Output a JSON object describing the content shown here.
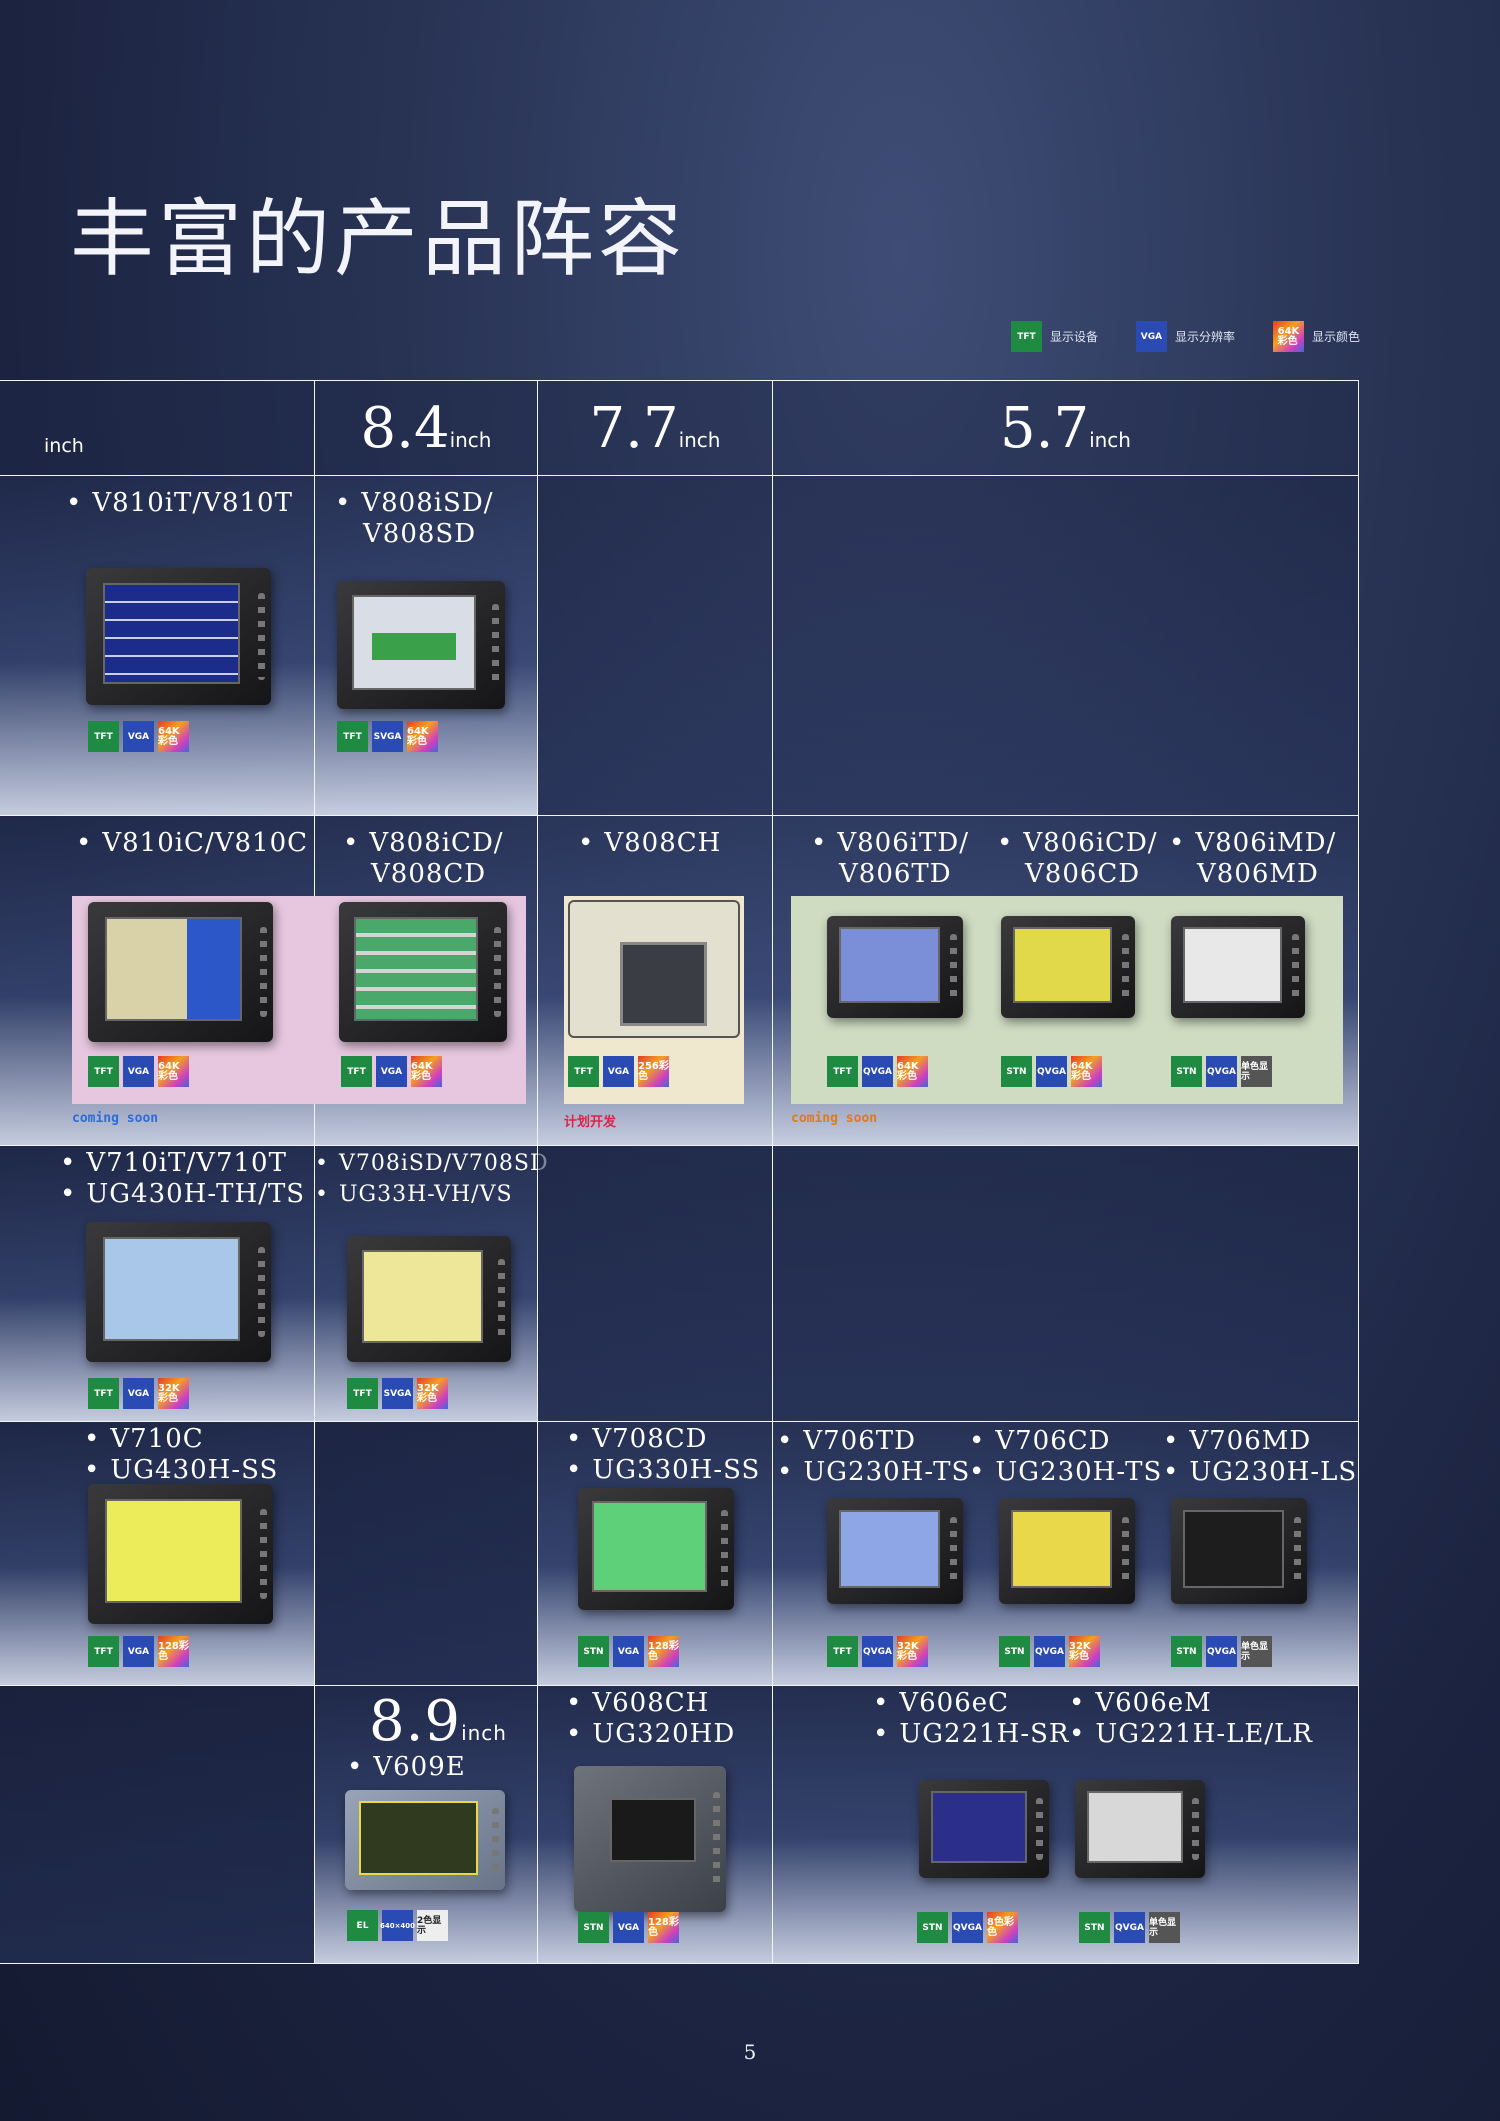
{
  "title": "丰富的产品阵容",
  "legend": [
    {
      "badge": "TFT",
      "label": "显示设备",
      "kind": "tft"
    },
    {
      "badge": "VGA",
      "label": "显示分辨率",
      "kind": "vga"
    },
    {
      "badge": "64K\n彩色",
      "label": "显示颜色",
      "kind": "col"
    }
  ],
  "headers": {
    "col1": "inch",
    "col2_num": "8.4",
    "col3_num": "7.7",
    "col4_num": "5.7",
    "unit": "inch"
  },
  "rows": {
    "r1": {
      "c1": [
        "V810iT/V810T"
      ],
      "c2": [
        "V808iSD/",
        "V808SD"
      ],
      "c1_badges": [
        "TFT",
        "VGA",
        "64K彩色"
      ],
      "c2_badges": [
        "TFT",
        "SVGA",
        "64K彩色"
      ]
    },
    "r2": {
      "c1": [
        "V810iC/V810C"
      ],
      "c2": [
        "V808iCD/",
        "V808CD"
      ],
      "c3": [
        "V808CH"
      ],
      "c4a": [
        "V806iTD/",
        "V806TD"
      ],
      "c4b": [
        "V806iCD/",
        "V806CD"
      ],
      "c4c": [
        "V806iMD/",
        "V806MD"
      ],
      "c1_badges": [
        "TFT",
        "VGA",
        "64K彩色"
      ],
      "c2_badges": [
        "TFT",
        "VGA",
        "64K彩色"
      ],
      "c3_badges": [
        "TFT",
        "VGA",
        "256彩色"
      ],
      "c4a_badges": [
        "TFT",
        "QVGA",
        "64K彩色"
      ],
      "c4b_badges": [
        "STN",
        "QVGA",
        "64K彩色"
      ],
      "c4c_badges": [
        "STN",
        "QVGA",
        "单色显示"
      ],
      "note1": "coming soon",
      "note3": "计划开发",
      "note4": "coming soon"
    },
    "r3": {
      "c1": [
        "V710iT/V710T",
        "UG430H-TH/TS"
      ],
      "c2": [
        "V708iSD/V708SD",
        "UG33H-VH/VS"
      ],
      "c1_badges": [
        "TFT",
        "VGA",
        "32K彩色"
      ],
      "c2_badges": [
        "TFT",
        "SVGA",
        "32K彩色"
      ]
    },
    "r4": {
      "c1": [
        "V710C",
        "UG430H-SS"
      ],
      "c3": [
        "V708CD",
        "UG330H-SS"
      ],
      "c4a": [
        "V706TD",
        "UG230H-TS"
      ],
      "c4b": [
        "V706CD",
        "UG230H-TS"
      ],
      "c4c": [
        "V706MD",
        "UG230H-LS"
      ],
      "c1_badges": [
        "TFT",
        "VGA",
        "128彩色"
      ],
      "c3_badges": [
        "STN",
        "VGA",
        "128彩色"
      ],
      "c4a_badges": [
        "TFT",
        "QVGA",
        "32K彩色"
      ],
      "c4b_badges": [
        "STN",
        "QVGA",
        "32K彩色"
      ],
      "c4c_badges": [
        "STN",
        "QVGA",
        "单色显示"
      ]
    },
    "r5": {
      "c2_num": "8.9",
      "c2": [
        "V609E"
      ],
      "c3": [
        "V608CH",
        "UG320HD"
      ],
      "c4a": [
        "V606eC",
        "UG221H-SR"
      ],
      "c4b": [
        "V606eM",
        "UG221H-LE/LR"
      ],
      "c2_badges": [
        "EL",
        "640×400",
        "2色显示"
      ],
      "c3_badges": [
        "STN",
        "VGA",
        "128彩色"
      ],
      "c4a_badges": [
        "STN",
        "QVGA",
        "8色彩色"
      ],
      "c4b_badges": [
        "STN",
        "QVGA",
        "单色显示"
      ]
    }
  },
  "page_number": "5"
}
